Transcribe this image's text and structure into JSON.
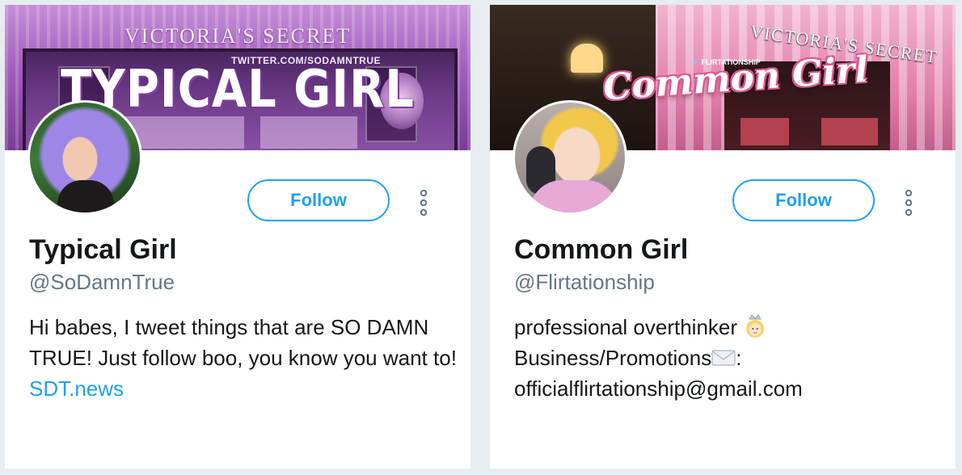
{
  "profiles": [
    {
      "banner": {
        "brand_text": "VICTORIA'S SECRET",
        "handle_text": "TWITTER.COM/SODAMNTRUE",
        "title_text": "TYPICAL GIRL"
      },
      "follow_label": "Follow",
      "name": "Typical Girl",
      "screen_name": "@SoDamnTrue",
      "bio_text": "Hi babes, I tweet things that are SO DAMN TRUE! Just follow boo, you know you want to! ",
      "bio_link": "SDT.news"
    },
    {
      "banner": {
        "brand_text": "VICTORIA'S SECRET",
        "handle_text": "FLIRTATIONSHIP",
        "title_text": "Common Girl"
      },
      "follow_label": "Follow",
      "name": "Common Girl",
      "screen_name": "@Flirtationship",
      "bio_line1": "professional overthinker",
      "bio_line2": "Business/Promotions",
      "bio_line2_suffix": ":",
      "bio_line3": "officialflirtationship@gmail.com"
    }
  ],
  "colors": {
    "accent": "#1da1f2",
    "name_text": "#14171a",
    "secondary_text": "#657786",
    "page_bg": "#e6ecf0"
  },
  "icons": {
    "more": "vertical-ellipsis-icon",
    "bird": "twitter-bird-icon",
    "princess": "princess-emoji-icon",
    "mail": "envelope-emoji-icon"
  }
}
